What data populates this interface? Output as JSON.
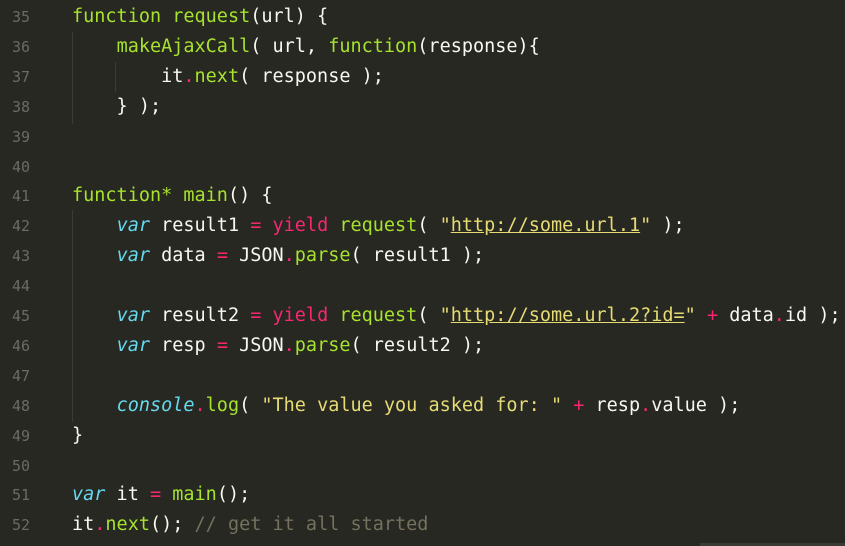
{
  "editor": {
    "colors": {
      "background": "#272822",
      "keyword": "#f92672",
      "function": "#a6e22e",
      "string": "#e6db74",
      "storage": "#66d9ef",
      "comment": "#75715e",
      "text": "#f8f8f2",
      "gutter": "#6b6b64"
    },
    "lines": [
      {
        "num": "35",
        "tokens": [
          {
            "t": "function",
            "c": "fn"
          },
          {
            "t": " ",
            "c": "txt"
          },
          {
            "t": "request",
            "c": "fn"
          },
          {
            "t": "(url) {",
            "c": "txt"
          }
        ]
      },
      {
        "num": "36",
        "tokens": [
          {
            "t": "    ",
            "c": "txt"
          },
          {
            "t": "makeAjaxCall",
            "c": "fn"
          },
          {
            "t": "( url, ",
            "c": "txt"
          },
          {
            "t": "function",
            "c": "fn"
          },
          {
            "t": "(response){",
            "c": "txt"
          }
        ]
      },
      {
        "num": "37",
        "tokens": [
          {
            "t": "        ",
            "c": "txt"
          },
          {
            "t": "it",
            "c": "txt"
          },
          {
            "t": ".",
            "c": "op"
          },
          {
            "t": "next",
            "c": "fn"
          },
          {
            "t": "( response );",
            "c": "txt"
          }
        ]
      },
      {
        "num": "38",
        "tokens": [
          {
            "t": "    } );",
            "c": "txt"
          }
        ]
      },
      {
        "num": "39",
        "tokens": []
      },
      {
        "num": "40",
        "tokens": []
      },
      {
        "num": "41",
        "tokens": [
          {
            "t": "function*",
            "c": "fn"
          },
          {
            "t": " ",
            "c": "txt"
          },
          {
            "t": "main",
            "c": "fn"
          },
          {
            "t": "() {",
            "c": "txt"
          }
        ]
      },
      {
        "num": "42",
        "tokens": [
          {
            "t": "    ",
            "c": "txt"
          },
          {
            "t": "var",
            "c": "sto"
          },
          {
            "t": " result1 ",
            "c": "txt"
          },
          {
            "t": "=",
            "c": "op"
          },
          {
            "t": " ",
            "c": "txt"
          },
          {
            "t": "yield",
            "c": "kw"
          },
          {
            "t": " ",
            "c": "txt"
          },
          {
            "t": "request",
            "c": "fn"
          },
          {
            "t": "( ",
            "c": "txt"
          },
          {
            "t": "\"",
            "c": "str"
          },
          {
            "t": "http://some.url.1",
            "c": "str url"
          },
          {
            "t": "\"",
            "c": "str"
          },
          {
            "t": " );",
            "c": "txt"
          }
        ]
      },
      {
        "num": "43",
        "tokens": [
          {
            "t": "    ",
            "c": "txt"
          },
          {
            "t": "var",
            "c": "sto"
          },
          {
            "t": " data ",
            "c": "txt"
          },
          {
            "t": "=",
            "c": "op"
          },
          {
            "t": " JSON",
            "c": "txt"
          },
          {
            "t": ".",
            "c": "op"
          },
          {
            "t": "parse",
            "c": "fn"
          },
          {
            "t": "( result1 );",
            "c": "txt"
          }
        ]
      },
      {
        "num": "44",
        "tokens": []
      },
      {
        "num": "45",
        "tokens": [
          {
            "t": "    ",
            "c": "txt"
          },
          {
            "t": "var",
            "c": "sto"
          },
          {
            "t": " result2 ",
            "c": "txt"
          },
          {
            "t": "=",
            "c": "op"
          },
          {
            "t": " ",
            "c": "txt"
          },
          {
            "t": "yield",
            "c": "kw"
          },
          {
            "t": " ",
            "c": "txt"
          },
          {
            "t": "request",
            "c": "fn"
          },
          {
            "t": "( ",
            "c": "txt"
          },
          {
            "t": "\"",
            "c": "str"
          },
          {
            "t": "http://some.url.2?id=",
            "c": "str url"
          },
          {
            "t": "\"",
            "c": "str"
          },
          {
            "t": " ",
            "c": "txt"
          },
          {
            "t": "+",
            "c": "op"
          },
          {
            "t": " data",
            "c": "txt"
          },
          {
            "t": ".",
            "c": "op"
          },
          {
            "t": "id );",
            "c": "txt"
          }
        ]
      },
      {
        "num": "46",
        "tokens": [
          {
            "t": "    ",
            "c": "txt"
          },
          {
            "t": "var",
            "c": "sto"
          },
          {
            "t": " resp ",
            "c": "txt"
          },
          {
            "t": "=",
            "c": "op"
          },
          {
            "t": " JSON",
            "c": "txt"
          },
          {
            "t": ".",
            "c": "op"
          },
          {
            "t": "parse",
            "c": "fn"
          },
          {
            "t": "( result2 );",
            "c": "txt"
          }
        ]
      },
      {
        "num": "47",
        "tokens": []
      },
      {
        "num": "48",
        "tokens": [
          {
            "t": "    ",
            "c": "txt"
          },
          {
            "t": "console",
            "c": "sto"
          },
          {
            "t": ".",
            "c": "op"
          },
          {
            "t": "log",
            "c": "fn"
          },
          {
            "t": "( ",
            "c": "txt"
          },
          {
            "t": "\"The value you asked for: \"",
            "c": "str"
          },
          {
            "t": " ",
            "c": "txt"
          },
          {
            "t": "+",
            "c": "op"
          },
          {
            "t": " resp",
            "c": "txt"
          },
          {
            "t": ".",
            "c": "op"
          },
          {
            "t": "value );",
            "c": "txt"
          }
        ]
      },
      {
        "num": "49",
        "tokens": [
          {
            "t": "}",
            "c": "txt"
          }
        ]
      },
      {
        "num": "50",
        "tokens": []
      },
      {
        "num": "51",
        "tokens": [
          {
            "t": "var",
            "c": "sto"
          },
          {
            "t": " it ",
            "c": "txt"
          },
          {
            "t": "=",
            "c": "op"
          },
          {
            "t": " ",
            "c": "txt"
          },
          {
            "t": "main",
            "c": "fn"
          },
          {
            "t": "();",
            "c": "txt"
          }
        ]
      },
      {
        "num": "52",
        "tokens": [
          {
            "t": "it",
            "c": "txt"
          },
          {
            "t": ".",
            "c": "op"
          },
          {
            "t": "next",
            "c": "fn"
          },
          {
            "t": "(); ",
            "c": "txt"
          },
          {
            "t": "// get it all started",
            "c": "cm"
          }
        ]
      }
    ]
  }
}
